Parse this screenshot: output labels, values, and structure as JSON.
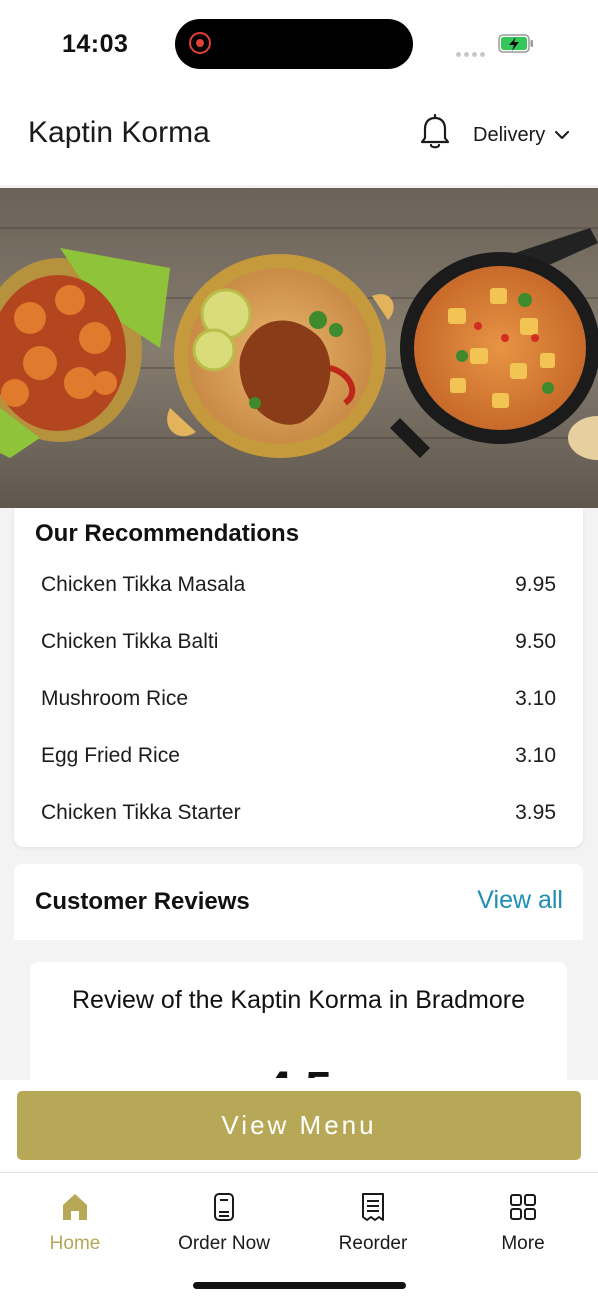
{
  "status_bar": {
    "time": "14:03"
  },
  "header": {
    "title": "Kaptin Korma",
    "delivery_label": "Delivery"
  },
  "recommendations": {
    "title": "Our Recommendations",
    "items": [
      {
        "name": "Chicken Tikka Masala",
        "price": "9.95"
      },
      {
        "name": "Chicken Tikka Balti",
        "price": "9.50"
      },
      {
        "name": "Mushroom Rice",
        "price": "3.10"
      },
      {
        "name": "Egg Fried Rice",
        "price": "3.10"
      },
      {
        "name": "Chicken Tikka Starter",
        "price": "3.95"
      }
    ]
  },
  "reviews": {
    "title": "Customer Reviews",
    "view_all_label": "View all",
    "card_heading": "Review of the Kaptin Korma in Bradmore",
    "score": "4.5"
  },
  "actions": {
    "view_menu_label": "View Menu"
  },
  "bottom_nav": {
    "items": [
      {
        "label": "Home",
        "icon": "home-icon",
        "active": true
      },
      {
        "label": "Order Now",
        "icon": "order-now-icon",
        "active": false
      },
      {
        "label": "Reorder",
        "icon": "receipt-icon",
        "active": false
      },
      {
        "label": "More",
        "icon": "grid-icon",
        "active": false
      }
    ]
  },
  "colors": {
    "accent": "#b7a857",
    "link": "#1e8eb3",
    "background": "#f3f3f3"
  }
}
